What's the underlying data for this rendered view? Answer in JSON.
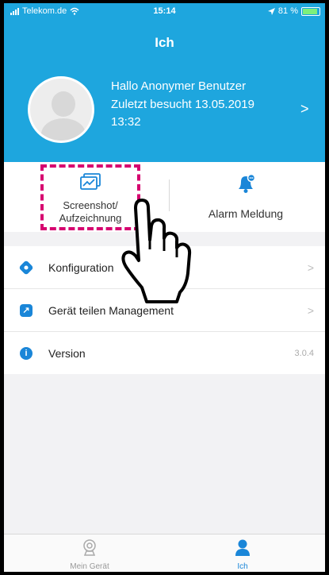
{
  "status_bar": {
    "carrier": "Telekom.de",
    "time": "15:14",
    "battery": "81 %"
  },
  "header": {
    "title": "Ich",
    "greeting": "Hallo Anonymer Benutzer",
    "last_visit": "Zuletzt besucht 13.05.2019 13:32",
    "chevron": ">"
  },
  "quick_actions": {
    "screenshot_label": "Screenshot/ Aufzeichnung",
    "alarm_label": "Alarm Meldung"
  },
  "menu": {
    "items": [
      {
        "label": "Konfiguration",
        "chevron": ">"
      },
      {
        "label": "Gerät teilen Management",
        "chevron": ">"
      },
      {
        "label": "Version",
        "value": "3.0.4"
      }
    ]
  },
  "tabbar": {
    "tabs": [
      {
        "label": "Mein Gerät"
      },
      {
        "label": "Ich"
      }
    ]
  },
  "colors": {
    "header_bg": "#1ea6de",
    "highlight": "#d6006f",
    "accent": "#1a86d8"
  }
}
